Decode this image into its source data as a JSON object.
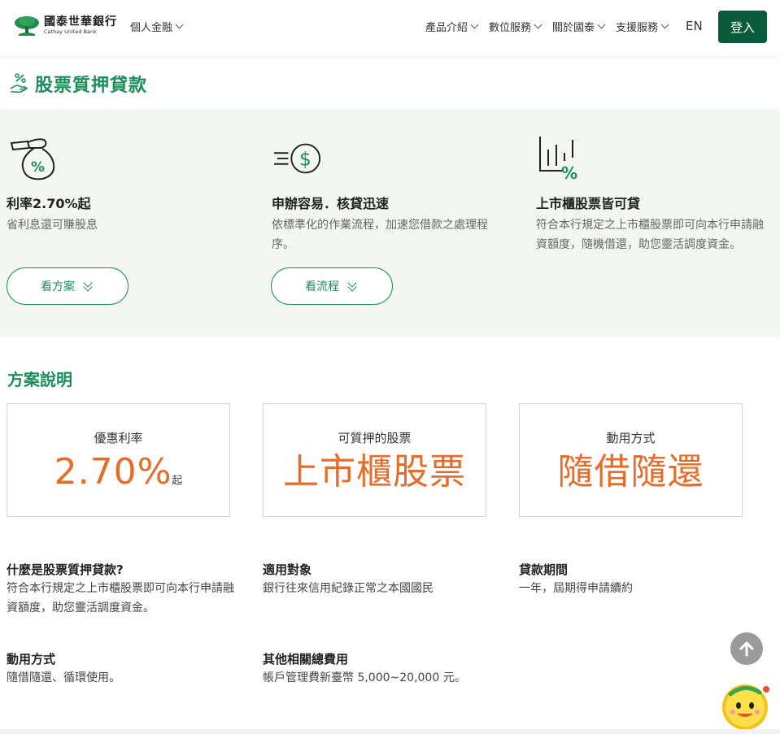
{
  "header": {
    "brand_cn": "國泰世華銀行",
    "brand_en": "Cathay United Bank",
    "personal_menu": "個人金融",
    "nav": [
      "產品介紹",
      "數位服務",
      "關於國泰",
      "支援服務"
    ],
    "lang": "EN",
    "login": "登入"
  },
  "page": {
    "title": "股票質押貸款"
  },
  "features": [
    {
      "title": "利率2.70%起",
      "desc": "省利息還可賺股息",
      "button": "看方案"
    },
    {
      "title": "申辦容易．核貸迅速",
      "desc": "依標準化的作業流程，加速您借款之處理程序。",
      "button": "看流程"
    },
    {
      "title": "上市櫃股票皆可貸",
      "desc": "符合本行規定之上市櫃股票即可向本行申請融資額度，隨機借還，助您靈活調度資金。"
    }
  ],
  "plan": {
    "title": "方案說明",
    "cards": [
      {
        "label": "優惠利率",
        "value": "2.70%",
        "suffix": "起"
      },
      {
        "label": "可質押的股票",
        "value": "上市櫃股票"
      },
      {
        "label": "動用方式",
        "value": "隨借隨還"
      }
    ],
    "info": [
      {
        "heading": "什麼是股票質押貸款?",
        "body": "符合本行規定之上市櫃股票即可向本行申請融資額度，助您靈活調度資金。"
      },
      {
        "heading": "適用對象",
        "body": "銀行往來信用紀錄正常之本國國民"
      },
      {
        "heading": "貸款期間",
        "body": "一年，屆期得申請續約"
      },
      {
        "heading": "動用方式",
        "body": "隨借隨還、循環使用。"
      },
      {
        "heading": "其他相關總費用",
        "body": "帳戶管理費新臺幣 5,000~20,000 元。"
      }
    ]
  },
  "colors": {
    "brand_green": "#0a5b3c",
    "accent_green": "#1a8f5a",
    "highlight_orange": "#e66c29"
  },
  "icons": [
    "tree-logo-icon",
    "hand-percent-icon",
    "money-bag-percent-icon",
    "fast-dollar-icon",
    "chart-percent-icon",
    "double-chevron-down-icon",
    "arrow-up-icon",
    "chatbot-mascot-icon"
  ]
}
